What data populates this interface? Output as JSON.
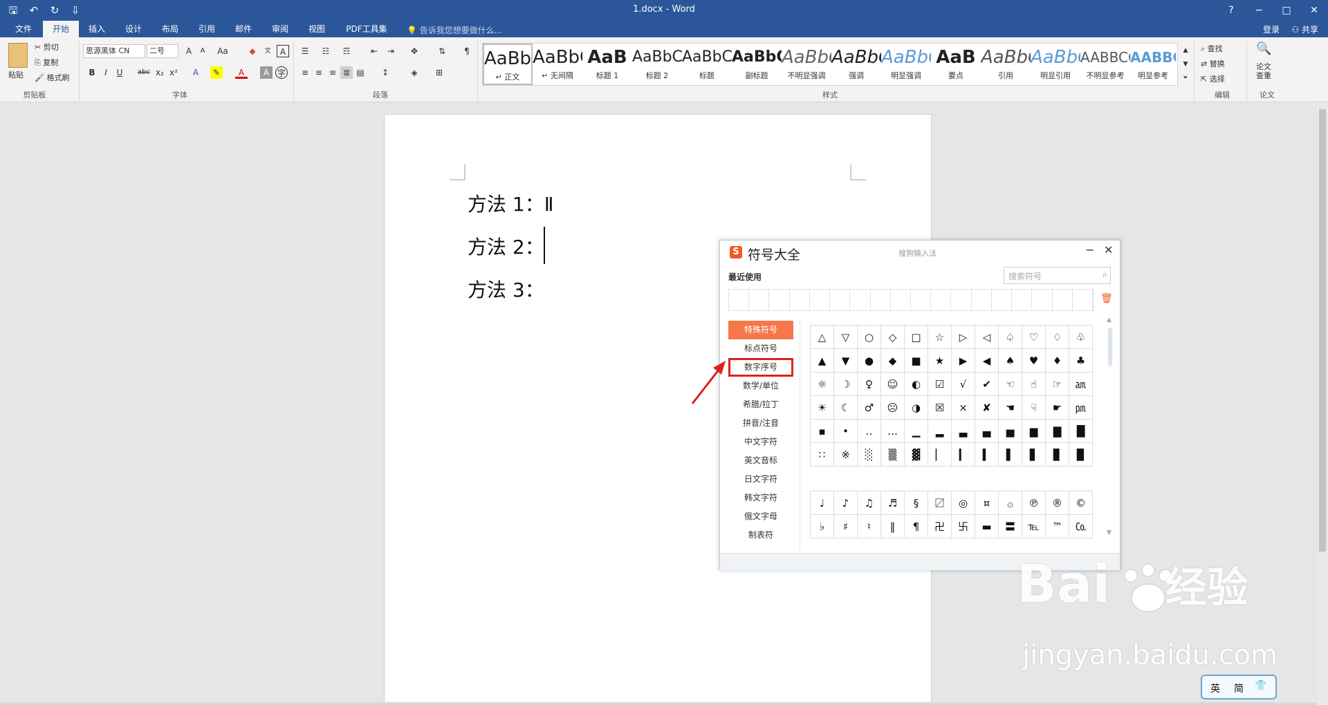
{
  "window": {
    "title": "1.docx - Word",
    "controls": [
      "?",
      "−",
      "□",
      "✕"
    ]
  },
  "qat": {
    "save": "🖫",
    "undo": "↶",
    "redo": "↻",
    "more": "⇩"
  },
  "tabs": [
    {
      "label": "文件"
    },
    {
      "label": "开始"
    },
    {
      "label": "插入"
    },
    {
      "label": "设计"
    },
    {
      "label": "布局"
    },
    {
      "label": "引用"
    },
    {
      "label": "邮件"
    },
    {
      "label": "审阅"
    },
    {
      "label": "视图"
    },
    {
      "label": "PDF工具集"
    }
  ],
  "tell_me": "告诉我您想要做什么...",
  "account": {
    "login": "登录",
    "share": "共享"
  },
  "clipboard": {
    "paste": "粘贴",
    "cut": "剪切",
    "copy": "复制",
    "format_painter": "格式刷",
    "group": "剪贴板"
  },
  "font": {
    "name": "思源黑体 CN",
    "size": "二号",
    "case": "Aa",
    "bold": "B",
    "italic": "I",
    "underline": "U",
    "strike": "abc",
    "sub": "x₂",
    "sup": "x²",
    "group": "字体"
  },
  "paragraph": {
    "group": "段落"
  },
  "styles": {
    "group": "样式",
    "items": [
      {
        "preview": "AaBbCcI",
        "name": "↵ 正文"
      },
      {
        "preview": "AaBbCcI",
        "name": "↵ 无间隔"
      },
      {
        "preview": "AaB",
        "name": "标题 1"
      },
      {
        "preview": "AaBbC(",
        "name": "标题 2"
      },
      {
        "preview": "AaBbC(",
        "name": "标题"
      },
      {
        "preview": "AaBbC(",
        "name": "副标题"
      },
      {
        "preview": "AaBbCcI",
        "name": "不明显强调"
      },
      {
        "preview": "AaBbCcI",
        "name": "强调"
      },
      {
        "preview": "AaBbCcI",
        "name": "明显强调"
      },
      {
        "preview": "AaB",
        "name": "要点"
      },
      {
        "preview": "AaBbCcI",
        "name": "引用"
      },
      {
        "preview": "AaBbCcI",
        "name": "明显引用"
      },
      {
        "preview": "AABBCCI",
        "name": "不明显参考"
      },
      {
        "preview": "AABBCCI",
        "name": "明显参考"
      }
    ]
  },
  "editing": {
    "find": "查找",
    "replace": "替换",
    "select": "选择",
    "group": "编辑"
  },
  "paper": {
    "check": "论文查重",
    "group": "论文"
  },
  "document": {
    "lines": [
      "方法 1：Ⅱ",
      "方法 2：",
      "方法 3："
    ]
  },
  "symbol_dialog": {
    "logo": "S",
    "title": "符号大全",
    "subtitle": "搜狗输入法",
    "minimize": "−",
    "close": "✕",
    "recent_label": "最近使用",
    "search_placeholder": "搜索符号",
    "categories": [
      "特殊符号",
      "标点符号",
      "数字序号",
      "数学/单位",
      "希腊/拉丁",
      "拼音/注音",
      "中文字符",
      "英文音标",
      "日文字符",
      "韩文字符",
      "俄文字母",
      "制表符"
    ],
    "active_category": "特殊符号",
    "highlighted_category": "数字序号",
    "grid1": [
      [
        "△",
        "▽",
        "○",
        "◇",
        "□",
        "☆",
        "▷",
        "◁",
        "♤",
        "♡",
        "♢",
        "♧"
      ],
      [
        "▲",
        "▼",
        "●",
        "◆",
        "■",
        "★",
        "▶",
        "◀",
        "♠",
        "♥",
        "♦",
        "♣"
      ],
      [
        "☼",
        "☽",
        "♀",
        "☺",
        "◐",
        "☑",
        "√",
        "✔",
        "☜",
        "☝",
        "☞",
        "㏂"
      ],
      [
        "☀",
        "☾",
        "♂",
        "☹",
        "◑",
        "☒",
        "×",
        "✘",
        "☚",
        "☟",
        "☛",
        "㏘"
      ],
      [
        "▪",
        "•",
        "‥",
        "…",
        "▁",
        "▂",
        "▃",
        "▄",
        "▅",
        "▆",
        "▇",
        "█"
      ],
      [
        "∷",
        "※",
        "░",
        "▒",
        "▓",
        "▏",
        "▎",
        "▍",
        "▌",
        "▋",
        "▊",
        "▉"
      ]
    ],
    "grid2": [
      [
        "♩",
        "♪",
        "♫",
        "♬",
        "§",
        "〼",
        "◎",
        "¤",
        "۞",
        "℗",
        "®",
        "©"
      ],
      [
        "♭",
        "♯",
        "♮",
        "‖",
        "¶",
        "卍",
        "卐",
        "▬",
        "〓",
        "℡",
        "™",
        "㏇"
      ]
    ]
  },
  "watermark": {
    "brand": "Bai",
    "brand2": "经验",
    "url": "jingyan.baidu.com"
  },
  "ime": {
    "lang": "英",
    "mode": "简",
    "icons": "👕"
  }
}
